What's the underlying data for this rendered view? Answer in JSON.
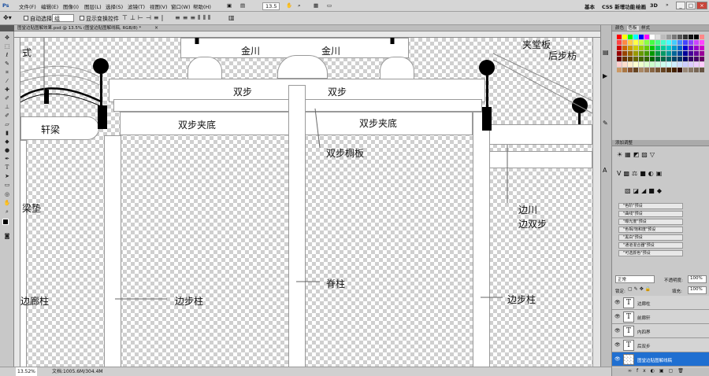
{
  "app": {
    "logo": "Ps"
  },
  "menu": {
    "items": [
      "文件(F)",
      "编辑(E)",
      "图像(I)",
      "图层(L)",
      "选择(S)",
      "滤镜(T)",
      "视图(V)",
      "窗口(W)",
      "帮助(H)"
    ],
    "zoom": "13.5",
    "workspaces": [
      "基本",
      "CSS 新增功能",
      "绘画",
      "3D"
    ]
  },
  "options": {
    "autoselect_label": "自动选择:",
    "autoselect_value": "组",
    "transform_label": "显示变换控件"
  },
  "document": {
    "tab_title": "图堂边贴图解效果.psd @ 13.5% (图堂边贴图解线稿, RGB/8) *"
  },
  "status": {
    "zoom": "13.52%",
    "doc": "文档:1005.6M/304.4M"
  },
  "canvas_labels": {
    "style_partial": "式",
    "jinchuan_left": "金川",
    "jinchuan_right": "金川",
    "shuangbu_left": "双步",
    "shuangbu_right": "双步",
    "xuanliang": "轩梁",
    "shuangbu_jiadi_left": "双步夹底",
    "shuangbu_jiadi_right": "双步夹底",
    "shuangbu_chengban": "双步椆板",
    "jiatangban": "夹堂板",
    "houbufang": "后步枋",
    "bianchuan": "边川",
    "bianshuangbu": "边双步",
    "liangdian": "梁垫",
    "jizhu": "脊柱",
    "bianbuzhu_left": "边步柱",
    "bianbuzhu_right": "边步柱",
    "bianlangzhu": "边廊柱"
  },
  "panels": {
    "color_tabs": [
      "颜色",
      "色板",
      "样式"
    ],
    "adjust_title": "添加调整",
    "presets": [
      "\"色阶\"预设",
      "\"曲线\"预设",
      "\"曝光度\"预设",
      "\"色相/饱和度\"预设",
      "\"黑白\"预设",
      "\"通道混合器\"预设",
      "\"可选颜色\"预设"
    ],
    "layers": {
      "blend": "正常",
      "opacity_label": "不透明度:",
      "opacity": "100%",
      "lock_label": "锁定:",
      "fill_label": "填充:",
      "fill": "100%"
    },
    "layer_items": [
      {
        "name": "边廊柱",
        "type": "T"
      },
      {
        "name": "前廊轩",
        "type": "T"
      },
      {
        "name": "内四界",
        "type": "T"
      },
      {
        "name": "后双步",
        "type": "T"
      },
      {
        "name": "图堂边贴图解线稿",
        "type": "img",
        "selected": true
      }
    ]
  },
  "colors": {
    "accent": "#1f6fd1",
    "checker": "#cfcfcf",
    "menubar": "#d6d6d6",
    "panel": "#c9c9c9"
  }
}
